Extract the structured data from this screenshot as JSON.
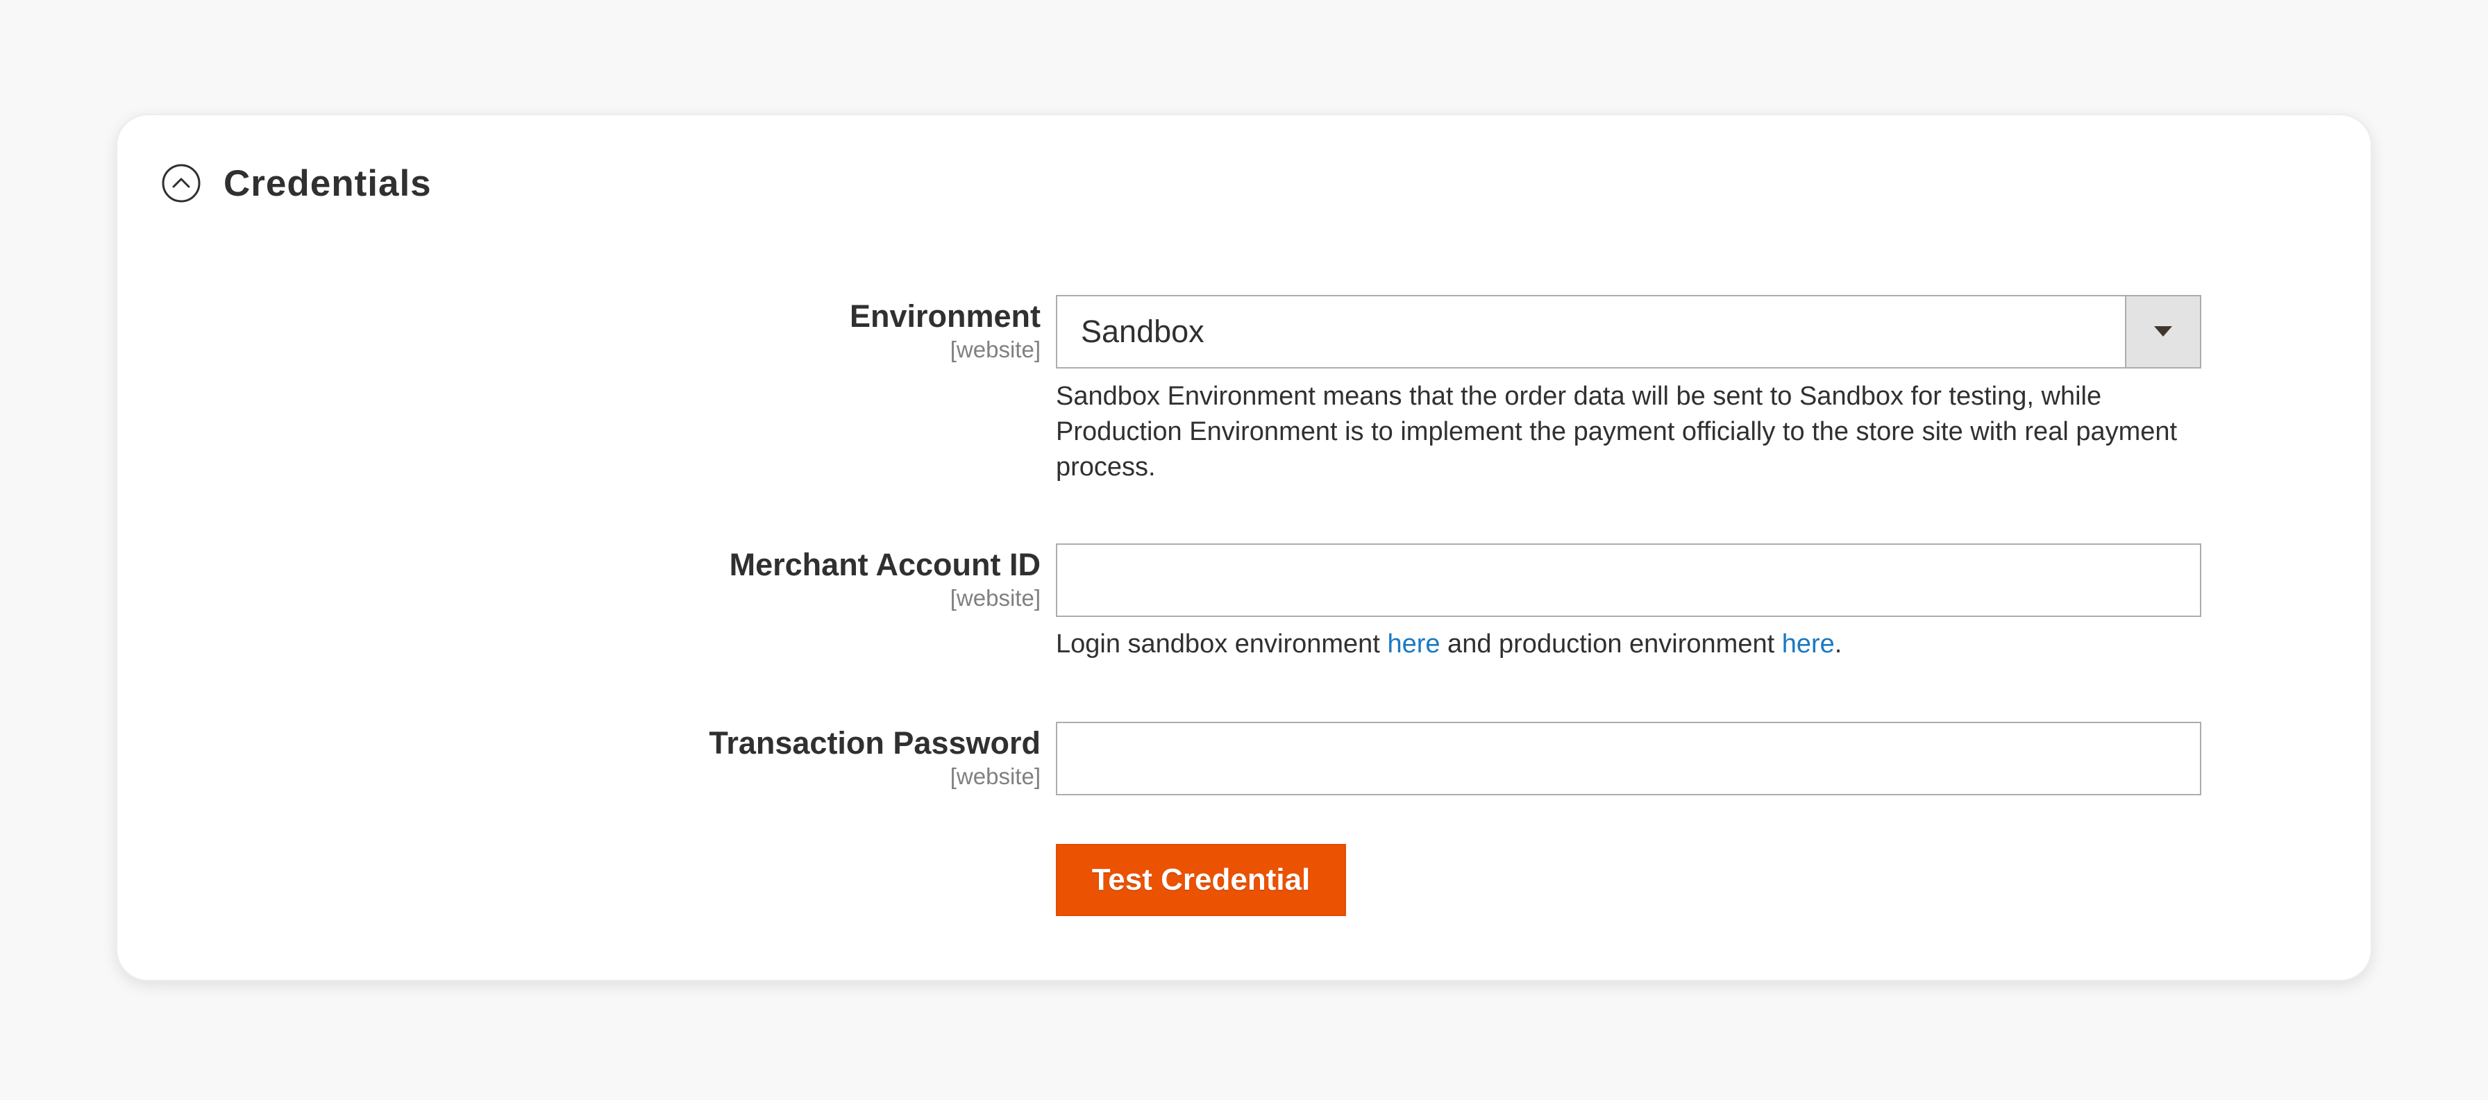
{
  "section": {
    "title": "Credentials",
    "expanded": true,
    "icon": "chevron-up-circle-icon"
  },
  "fields": {
    "environment": {
      "label": "Environment",
      "scope": "[website]",
      "value": "Sandbox",
      "note": "Sandbox Environment means that the order data will be sent to Sandbox for testing, while Production Environment is to implement the payment officially to the store site with real payment process.",
      "arrow_icon": "caret-down-icon"
    },
    "merchant_account_id": {
      "label": "Merchant Account ID",
      "scope": "[website]",
      "value": "",
      "note": {
        "prefix": "Login sandbox environment ",
        "link1": "here",
        "middle": " and production environment ",
        "link2": "here",
        "suffix": "."
      }
    },
    "transaction_password": {
      "label": "Transaction Password",
      "scope": "[website]",
      "value": ""
    }
  },
  "actions": {
    "test_credential": "Test Credential"
  },
  "colors": {
    "accent": "#eb5202",
    "link": "#1979c3",
    "page_background": "#f8f8f8",
    "card_background": "#ffffff",
    "text": "#303030",
    "muted_text": "#808080",
    "input_border": "#adadad"
  }
}
